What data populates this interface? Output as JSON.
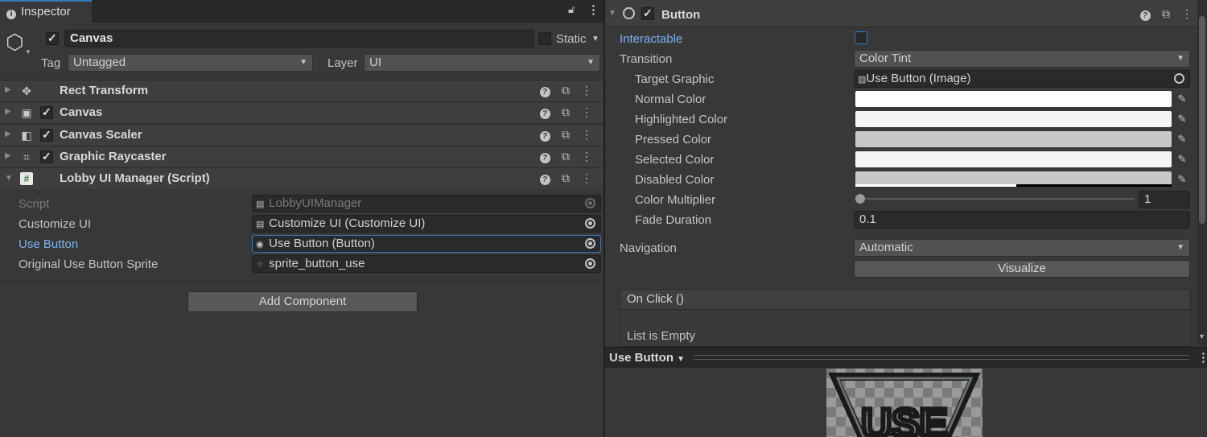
{
  "inspector": {
    "tab_label": "Inspector",
    "gameobject": {
      "name": "Canvas",
      "static_label": "Static",
      "tag_label": "Tag",
      "tag_value": "Untagged",
      "layer_label": "Layer",
      "layer_value": "UI"
    },
    "components": [
      {
        "title": "Rect Transform",
        "icon": "rect-transform-icon"
      },
      {
        "title": "Canvas",
        "icon": "canvas-icon"
      },
      {
        "title": "Canvas Scaler",
        "icon": "canvas-scaler-icon"
      },
      {
        "title": "Graphic Raycaster",
        "icon": "graphic-raycaster-icon"
      },
      {
        "title": "Lobby UI Manager (Script)",
        "icon": "script-icon"
      }
    ],
    "script_fields": [
      {
        "label": "Script",
        "value": "LobbyUIManager"
      },
      {
        "label": "Customize UI",
        "value": "Customize UI (Customize UI)"
      },
      {
        "label": "Use Button",
        "value": "Use Button (Button)"
      },
      {
        "label": "Original Use Button Sprite",
        "value": "sprite_button_use"
      }
    ],
    "add_component_label": "Add Component"
  },
  "button_component": {
    "title": "Button",
    "interactable_label": "Interactable",
    "transition_label": "Transition",
    "transition_value": "Color Tint",
    "target_graphic_label": "Target Graphic",
    "target_graphic_value": "Use Button (Image)",
    "normal_color_label": "Normal Color",
    "highlighted_color_label": "Highlighted Color",
    "pressed_color_label": "Pressed Color",
    "selected_color_label": "Selected Color",
    "disabled_color_label": "Disabled Color",
    "color_multiplier_label": "Color Multiplier",
    "color_multiplier_value": "1",
    "fade_duration_label": "Fade Duration",
    "fade_duration_value": "0.1",
    "navigation_label": "Navigation",
    "navigation_value": "Automatic",
    "visualize_label": "Visualize",
    "on_click_label": "On Click ()",
    "list_empty_label": "List is Empty",
    "colors": {
      "normal": "#ffffff",
      "highlighted": "#f5f5f5",
      "pressed": "#c8c8c8",
      "selected": "#f5f5f5",
      "disabled": "#c8c8c8"
    }
  },
  "preview": {
    "title": "Use Button",
    "image_text": "USE"
  }
}
